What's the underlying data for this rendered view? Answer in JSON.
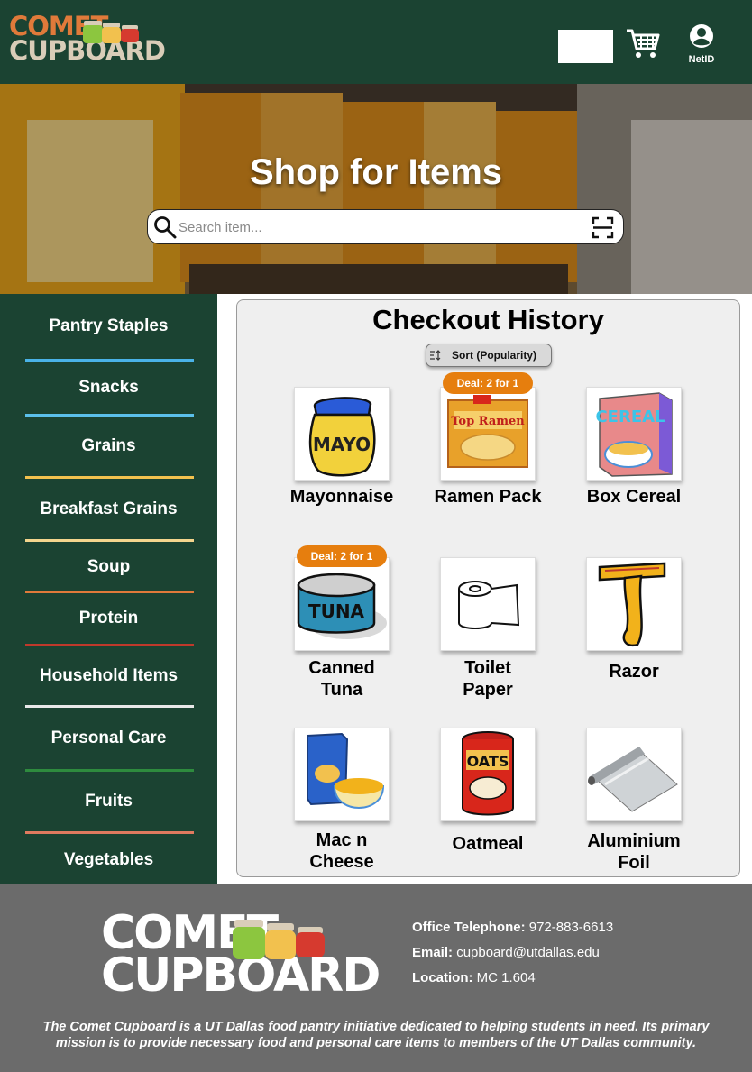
{
  "header": {
    "logo_line1": "COMET",
    "logo_line2": "CUPBOARD",
    "profile_label": "NetID",
    "bg_color": "#1b4332"
  },
  "hero": {
    "title": "Shop for Items",
    "search_placeholder": "Search item..."
  },
  "sidebar": {
    "categories": [
      {
        "label": "Pantry Staples",
        "color": "#4ab3e8"
      },
      {
        "label": "Snacks",
        "color": "#5bc0eb"
      },
      {
        "label": "Grains",
        "color": "#f2c14e"
      },
      {
        "label": "Breakfast Grains",
        "color": "#f4d58d"
      },
      {
        "label": "Soup",
        "color": "#e07a3a"
      },
      {
        "label": "Protein",
        "color": "#c0392b"
      },
      {
        "label": "Household Items",
        "color": "#e8e8e8"
      },
      {
        "label": "Personal Care",
        "color": "#2e8b3e"
      },
      {
        "label": "Fruits",
        "color": "#e07a5f"
      },
      {
        "label": "Vegetables",
        "color": "#1b4332"
      }
    ]
  },
  "main": {
    "title": "Checkout History",
    "sort_label": "Sort (Popularity)",
    "items": [
      {
        "name": "Mayonnaise",
        "icon": "mayo-jar-icon"
      },
      {
        "name": "Ramen Pack",
        "icon": "ramen-pack-icon",
        "deal": "Deal: 2 for 1"
      },
      {
        "name": "Box Cereal",
        "icon": "cereal-box-icon"
      },
      {
        "name_line1": "Canned",
        "name_line2": "Tuna",
        "icon": "tuna-can-icon",
        "deal": "Deal: 2 for 1"
      },
      {
        "name_line1": "Toilet",
        "name_line2": "Paper",
        "icon": "toilet-paper-icon"
      },
      {
        "name": "Razor",
        "icon": "razor-icon"
      },
      {
        "name_line1": "Mac n",
        "name_line2": "Cheese",
        "icon": "mac-cheese-icon"
      },
      {
        "name": "Oatmeal",
        "icon": "oatmeal-icon"
      },
      {
        "name_line1": "Aluminium",
        "name_line2": "Foil",
        "icon": "aluminium-foil-icon"
      }
    ],
    "deal_color": "#e67e0e"
  },
  "footer": {
    "logo_line1": "COMET",
    "logo_line2": "CUPBOARD",
    "phone_label": "Office Telephone:",
    "phone_value": "972-883-6613",
    "email_label": "Email:",
    "email_value": "cupboard@utdallas.edu",
    "location_label": "Location:",
    "location_value": "MC 1.604",
    "description": "The Comet Cupboard is a UT Dallas food pantry initiative dedicated to helping students in need. Its primary mission is to provide necessary food and personal care items to members of the UT Dallas community."
  }
}
